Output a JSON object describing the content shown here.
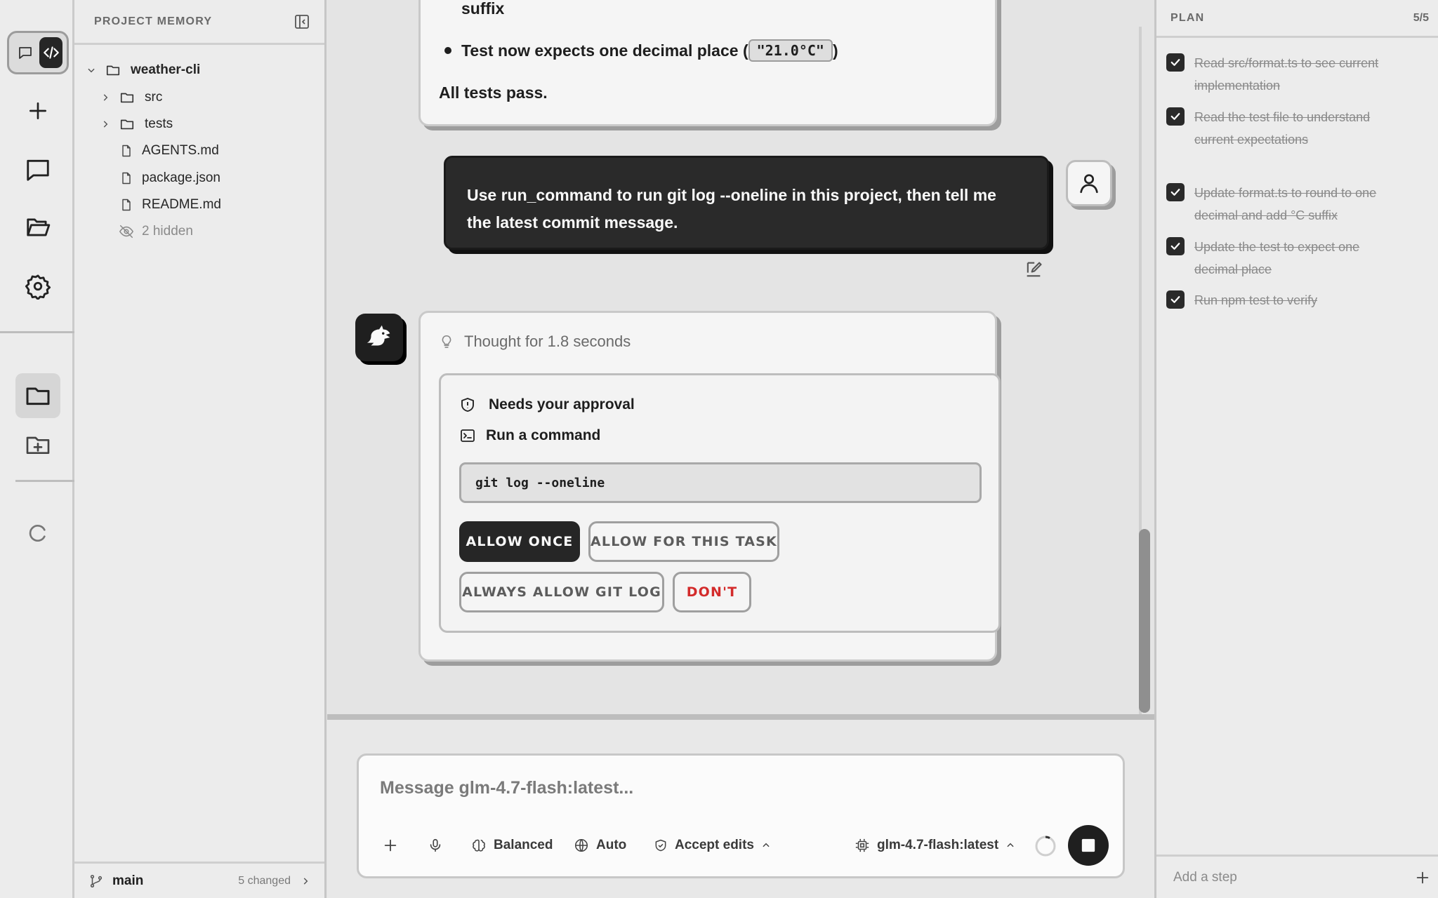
{
  "rail": {
    "icons": [
      "chat-icon",
      "code-icon",
      "plus-icon",
      "message-icon",
      "folder-open-icon",
      "gear-icon",
      "folder-icon",
      "folder-plus-icon",
      "spinner-icon"
    ]
  },
  "project": {
    "title": "PROJECT MEMORY",
    "root": "weather-cli",
    "folders": [
      "src",
      "tests"
    ],
    "files": [
      "AGENTS.md",
      "package.json",
      "README.md"
    ],
    "hidden": "2 hidden",
    "branch": "main",
    "changed": "5 changed"
  },
  "chat": {
    "prev_bullet_cut": "suffix",
    "prev_bullet_text": "Test now expects one decimal place (",
    "prev_bullet_code": "\"21.0°C\"",
    "prev_bullet_close": ")",
    "prev_summary": "All tests pass.",
    "user_message": "Use run_command to run git log --oneline in this project, then tell me the latest commit message.",
    "thought": "Thought for 1.8 seconds",
    "approval": {
      "title": "Needs your approval",
      "action": "Run a command",
      "command": "git log --oneline",
      "allow_once": "ALLOW ONCE",
      "allow_task": "ALLOW FOR THIS TASK",
      "always_allow": "ALWAYS ALLOW GIT LOG",
      "deny": "DON'T"
    }
  },
  "composer": {
    "placeholder": "Message glm-4.7-flash:latest...",
    "mode": "Balanced",
    "auto": "Auto",
    "edits": "Accept edits",
    "model": "glm-4.7-flash:latest"
  },
  "plan": {
    "title": "PLAN",
    "count": "5/5",
    "items": [
      "Read src/format.ts to see current implementation",
      "Read the test file to understand current expectations",
      "Update format.ts to round to one decimal and add °C suffix",
      "Update the test to expect one decimal place",
      "Run npm test to verify"
    ],
    "add_step": "Add a step"
  },
  "colors": {
    "accent": "#262626",
    "danger": "#d32b2b",
    "background": "#e4e4e4"
  }
}
